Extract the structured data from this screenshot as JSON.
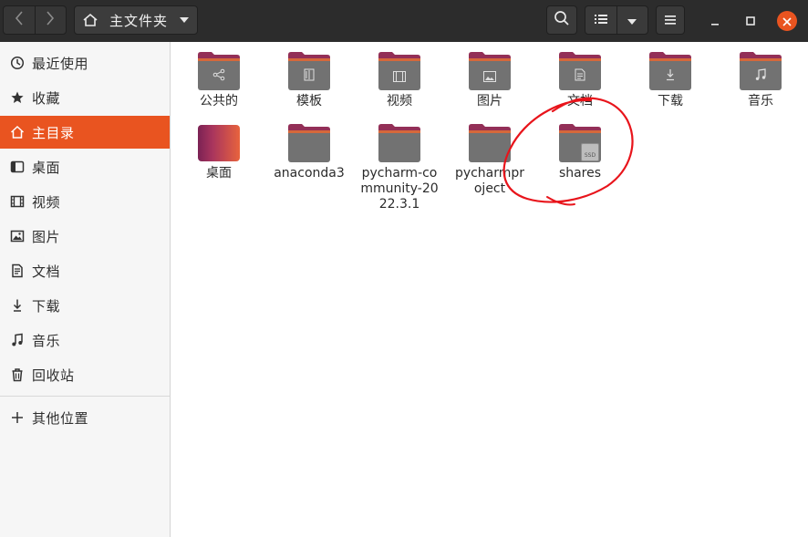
{
  "header": {
    "back_icon": "chevron-left-icon",
    "forward_icon": "chevron-right-icon",
    "path_label": "主文件夹",
    "search_icon": "search-icon",
    "list_view_icon": "list-view-icon",
    "view_options_icon": "chevron-down-icon",
    "menu_icon": "hamburger-menu-icon",
    "minimize_icon": "minimize-icon",
    "maximize_icon": "maximize-icon",
    "close_icon": "close-icon",
    "accent_color": "#e95420"
  },
  "sidebar": {
    "items": [
      {
        "label": "最近使用",
        "icon": "clock-icon"
      },
      {
        "label": "收藏",
        "icon": "star-icon"
      },
      {
        "label": "主目录",
        "icon": "home-icon",
        "active": true
      },
      {
        "label": "桌面",
        "icon": "desktop-icon"
      },
      {
        "label": "视频",
        "icon": "video-icon"
      },
      {
        "label": "图片",
        "icon": "image-icon"
      },
      {
        "label": "文档",
        "icon": "document-icon"
      },
      {
        "label": "下载",
        "icon": "download-icon"
      },
      {
        "label": "音乐",
        "icon": "music-icon"
      },
      {
        "label": "回收站",
        "icon": "trash-icon"
      },
      {
        "label": "其他位置",
        "icon": "plus-icon"
      }
    ]
  },
  "files": [
    {
      "name": "公共的",
      "emblem": "share-icon"
    },
    {
      "name": "模板",
      "emblem": "template-icon"
    },
    {
      "name": "视频",
      "emblem": "video-icon"
    },
    {
      "name": "图片",
      "emblem": "image-icon"
    },
    {
      "name": "文档",
      "emblem": "document-icon"
    },
    {
      "name": "下载",
      "emblem": "download-icon"
    },
    {
      "name": "音乐",
      "emblem": "music-icon"
    },
    {
      "name": "桌面",
      "emblem": "desktop-folder-icon"
    },
    {
      "name": "anaconda3",
      "emblem": ""
    },
    {
      "name": "pycharm-community-2022.3.1",
      "emblem": ""
    },
    {
      "name": "pycharmproject",
      "emblem": ""
    },
    {
      "name": "shares",
      "emblem": "ssd-drive-icon",
      "badge": "SSD"
    }
  ],
  "annotation": {
    "color": "#e8141b",
    "shape": "hand-drawn-circle"
  }
}
